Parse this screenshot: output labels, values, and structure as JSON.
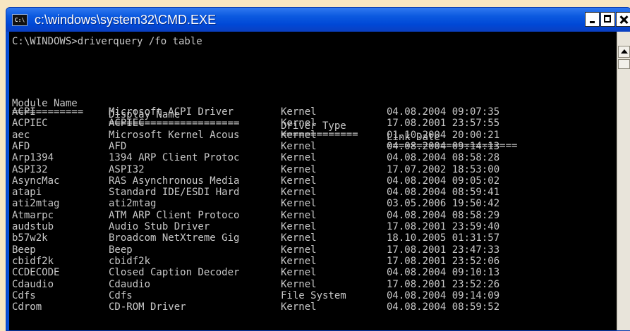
{
  "window": {
    "title": "c:\\windows\\system32\\CMD.EXE",
    "icon_text": "C:\\"
  },
  "console": {
    "command_line": "C:\\WINDOWS>driverquery /fo table",
    "headers": [
      "Module Name",
      "Display Name",
      "Driver Type",
      "Link Date"
    ],
    "separators": [
      "============",
      "======================",
      "=============",
      "======================"
    ],
    "rows": [
      [
        "ACPI",
        "Microsoft ACPI Driver",
        "Kernel",
        "04.08.2004 09:07:35"
      ],
      [
        "ACPIEC",
        "ACPIEC",
        "Kernel",
        "17.08.2001 23:57:55"
      ],
      [
        "aec",
        "Microsoft Kernel Acous",
        "Kernel",
        "01.10.2004 20:00:21"
      ],
      [
        "AFD",
        "AFD",
        "Kernel",
        "04.08.2004 09:14:13"
      ],
      [
        "Arp1394",
        "1394 ARP Client Protoc",
        "Kernel",
        "04.08.2004 08:58:28"
      ],
      [
        "ASPI32",
        "ASPI32",
        "Kernel",
        "17.07.2002 18:53:00"
      ],
      [
        "AsyncMac",
        "RAS Asynchronous Media",
        "Kernel",
        "04.08.2004 09:05:02"
      ],
      [
        "atapi",
        "Standard IDE/ESDI Hard",
        "Kernel",
        "04.08.2004 08:59:41"
      ],
      [
        "ati2mtag",
        "ati2mtag",
        "Kernel",
        "03.05.2006 19:50:42"
      ],
      [
        "Atmarpc",
        "ATM ARP Client Protoco",
        "Kernel",
        "04.08.2004 08:58:29"
      ],
      [
        "audstub",
        "Audio Stub Driver",
        "Kernel",
        "17.08.2001 23:59:40"
      ],
      [
        "b57w2k",
        "Broadcom NetXtreme Gig",
        "Kernel",
        "18.10.2005 01:31:57"
      ],
      [
        "Beep",
        "Beep",
        "Kernel",
        "17.08.2001 23:47:33"
      ],
      [
        "cbidf2k",
        "cbidf2k",
        "Kernel",
        "17.08.2001 23:52:06"
      ],
      [
        "CCDECODE",
        "Closed Caption Decoder",
        "Kernel",
        "04.08.2004 09:10:13"
      ],
      [
        "Cdaudio",
        "Cdaudio",
        "Kernel",
        "17.08.2001 23:52:26"
      ],
      [
        "Cdfs",
        "Cdfs",
        "File System",
        "04.08.2004 09:14:09"
      ],
      [
        "Cdrom",
        "CD-ROM Driver",
        "Kernel",
        "04.08.2004 08:59:52"
      ]
    ]
  },
  "icons": {
    "app": "console-icon",
    "minimize": "minimize-icon",
    "maximize": "maximize-icon",
    "close": "close-icon",
    "scroll_up": "scroll-up-arrow-icon"
  },
  "colors": {
    "titlebar": "#0048d6",
    "console_bg": "#000000",
    "console_text": "#c8c8c8",
    "page_bg": "#f7e6c2"
  }
}
